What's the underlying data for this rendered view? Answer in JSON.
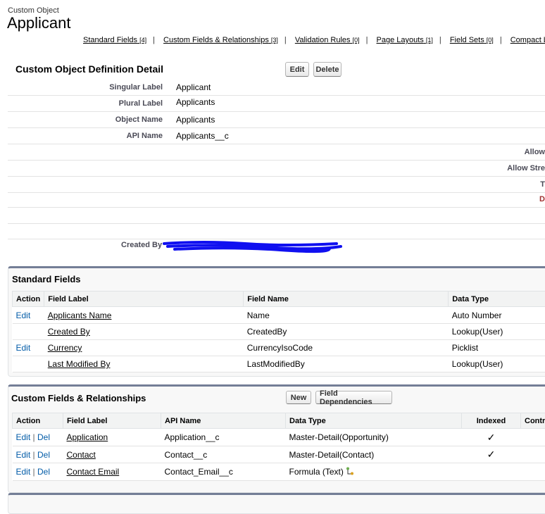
{
  "header": {
    "object_type": "Custom Object",
    "title": "Applicant"
  },
  "related_links": [
    {
      "label": "Standard Fields",
      "count": "[4]"
    },
    {
      "label": "Custom Fields & Relationships",
      "count": "[3]"
    },
    {
      "label": "Validation Rules",
      "count": "[0]"
    },
    {
      "label": "Page Layouts",
      "count": "[1]"
    },
    {
      "label": "Field Sets",
      "count": "[0]"
    },
    {
      "label": "Compact Lay",
      "count": ""
    }
  ],
  "detail": {
    "title": "Custom Object Definition Detail",
    "edit": "Edit",
    "delete": "Delete",
    "fields": [
      {
        "label": "Singular Label",
        "value": "Applicant"
      },
      {
        "label": "Plural Label",
        "value": "Applicants"
      },
      {
        "label": "Object Name",
        "value": "Applicants"
      },
      {
        "label": "API Name",
        "value": "Applicants__c"
      }
    ],
    "right_labels": [
      "Allow",
      "Allow Stre",
      "T",
      "D"
    ],
    "created_by_label": "Created By"
  },
  "standard_fields": {
    "title": "Standard Fields",
    "columns": [
      "Action",
      "Field Label",
      "Field Name",
      "Data Type"
    ],
    "rows": [
      {
        "action": "Edit",
        "label": "Applicants Name",
        "name": "Name",
        "type": "Auto Number"
      },
      {
        "action": "",
        "label": "Created By",
        "name": "CreatedBy",
        "type": "Lookup(User)"
      },
      {
        "action": "Edit",
        "label": "Currency",
        "name": "CurrencyIsoCode",
        "type": "Picklist"
      },
      {
        "action": "",
        "label": "Last Modified By",
        "name": "LastModifiedBy",
        "type": "Lookup(User)"
      }
    ]
  },
  "custom_fields": {
    "title": "Custom Fields & Relationships",
    "new": "New",
    "field_dependencies": "Field Dependencies",
    "columns": [
      "Action",
      "Field Label",
      "API Name",
      "Data Type",
      "Indexed",
      "Contr"
    ],
    "edit": "Edit",
    "del": "Del",
    "sep": "|",
    "rows": [
      {
        "label": "Application",
        "api": "Application__c",
        "type": "Master-Detail(Opportunity)",
        "indexed": "✓"
      },
      {
        "label": "Contact",
        "api": "Contact__c",
        "type": "Master-Detail(Contact)",
        "indexed": "✓"
      },
      {
        "label": "Contact Email",
        "api": "Contact_Email__c",
        "type": "Formula (Text)",
        "indexed": ""
      }
    ]
  }
}
